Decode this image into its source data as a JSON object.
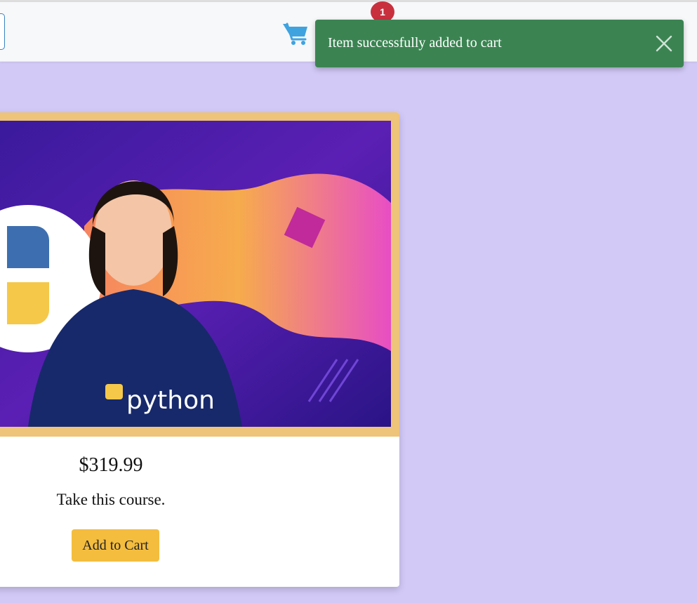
{
  "navbar": {
    "cart_badge_count": "1",
    "cart_icon": "shopping-cart-icon"
  },
  "toast": {
    "message": "Item successfully added to cart",
    "close_icon": "close-icon",
    "color": "#3b8452"
  },
  "product": {
    "image_text": "python",
    "price": "$319.99",
    "description": "Take this course.",
    "add_to_cart_label": "Add to Cart",
    "button_color": "#f4bd3e"
  },
  "page": {
    "background_color": "#d2c9f7",
    "cart_icon_color": "#3fa3e0"
  }
}
